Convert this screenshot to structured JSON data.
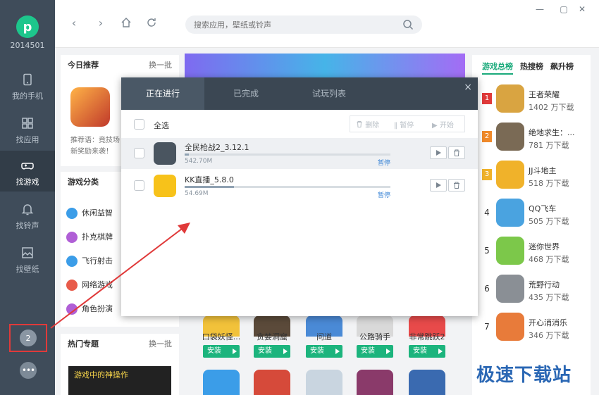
{
  "app": {
    "user_id": "2014501",
    "logo_letter": "p"
  },
  "nav": [
    {
      "label": "我的手机",
      "icon": "phone-icon"
    },
    {
      "label": "找应用",
      "icon": "apps-grid-icon"
    },
    {
      "label": "找游戏",
      "icon": "gamepad-icon",
      "active": true
    },
    {
      "label": "找铃声",
      "icon": "bell-icon"
    },
    {
      "label": "找壁纸",
      "icon": "image-icon"
    }
  ],
  "sidebar_bottom": {
    "download_count": "2",
    "more_label": "•••"
  },
  "search": {
    "placeholder": "搜索应用，壁纸或铃声"
  },
  "today": {
    "title": "今日推荐",
    "refresh": "换一批",
    "desc": "推荐语：竟技场新奖励来袭！"
  },
  "categories": {
    "title": "游戏分类",
    "items": [
      {
        "label": "休闲益智",
        "color": "#3b9de8"
      },
      {
        "label": "扑克棋牌",
        "color": "#b05fd6"
      },
      {
        "label": "飞行射击",
        "color": "#3b9de8"
      },
      {
        "label": "网络游戏",
        "color": "#e85b4a"
      },
      {
        "label": "角色扮演",
        "color": "#b05fd6"
      }
    ]
  },
  "topics": {
    "title": "热门专题",
    "refresh": "换一批",
    "banner_text": "游戏中的神操作"
  },
  "rank": {
    "tabs": [
      "游戏总榜",
      "热搜榜",
      "飙升榜"
    ],
    "items": [
      {
        "num": "1",
        "name": "王者荣耀",
        "downloads": "1402 万下载",
        "color": "#d9a441"
      },
      {
        "num": "2",
        "name": "绝地求生：...",
        "downloads": "781 万下载",
        "color": "#7a6a55"
      },
      {
        "num": "3",
        "name": "JJ斗地主",
        "downloads": "518 万下载",
        "color": "#f0b22a"
      },
      {
        "num": "4",
        "name": "QQ飞车",
        "downloads": "505 万下载",
        "color": "#4aa3e0"
      },
      {
        "num": "5",
        "name": "迷你世界",
        "downloads": "468 万下载",
        "color": "#7cc84a"
      },
      {
        "num": "6",
        "name": "荒野行动",
        "downloads": "435 万下载",
        "color": "#8a8f95"
      },
      {
        "num": "7",
        "name": "开心消消乐",
        "downloads": "346 万下载",
        "color": "#e87b3a"
      }
    ]
  },
  "grid": {
    "install_label": "安装",
    "row1": [
      {
        "name": "口袋妖怪...",
        "color": "#f2c23a"
      },
      {
        "name": "贪婪洞窟",
        "color": "#5b4a3a"
      },
      {
        "name": "问道",
        "color": "#4a8ad6"
      },
      {
        "name": "公路骑手",
        "color": "#d9d9d9"
      },
      {
        "name": "非常跳跃2",
        "color": "#e84a4a"
      }
    ],
    "row2_colors": [
      "#3b9de8",
      "#d64a3a",
      "#c9d5e0",
      "#8a3a6a",
      "#3a6ab0"
    ]
  },
  "download_dialog": {
    "tabs": [
      "正在进行",
      "已完成",
      "试玩列表"
    ],
    "close": "×",
    "select_all": "全选",
    "ops": [
      "删除",
      "暂停",
      "开始"
    ],
    "items": [
      {
        "name": "全民枪战2_3.12.1",
        "size": "542.70M",
        "status": "暂停",
        "progress": 0.02,
        "color": "#4a5560"
      },
      {
        "name": "KK直播_5.8.0",
        "size": "54.69M",
        "status": "暂停",
        "progress": 0.24,
        "color": "#f7c21a"
      }
    ]
  },
  "watermark": "极速下载站"
}
